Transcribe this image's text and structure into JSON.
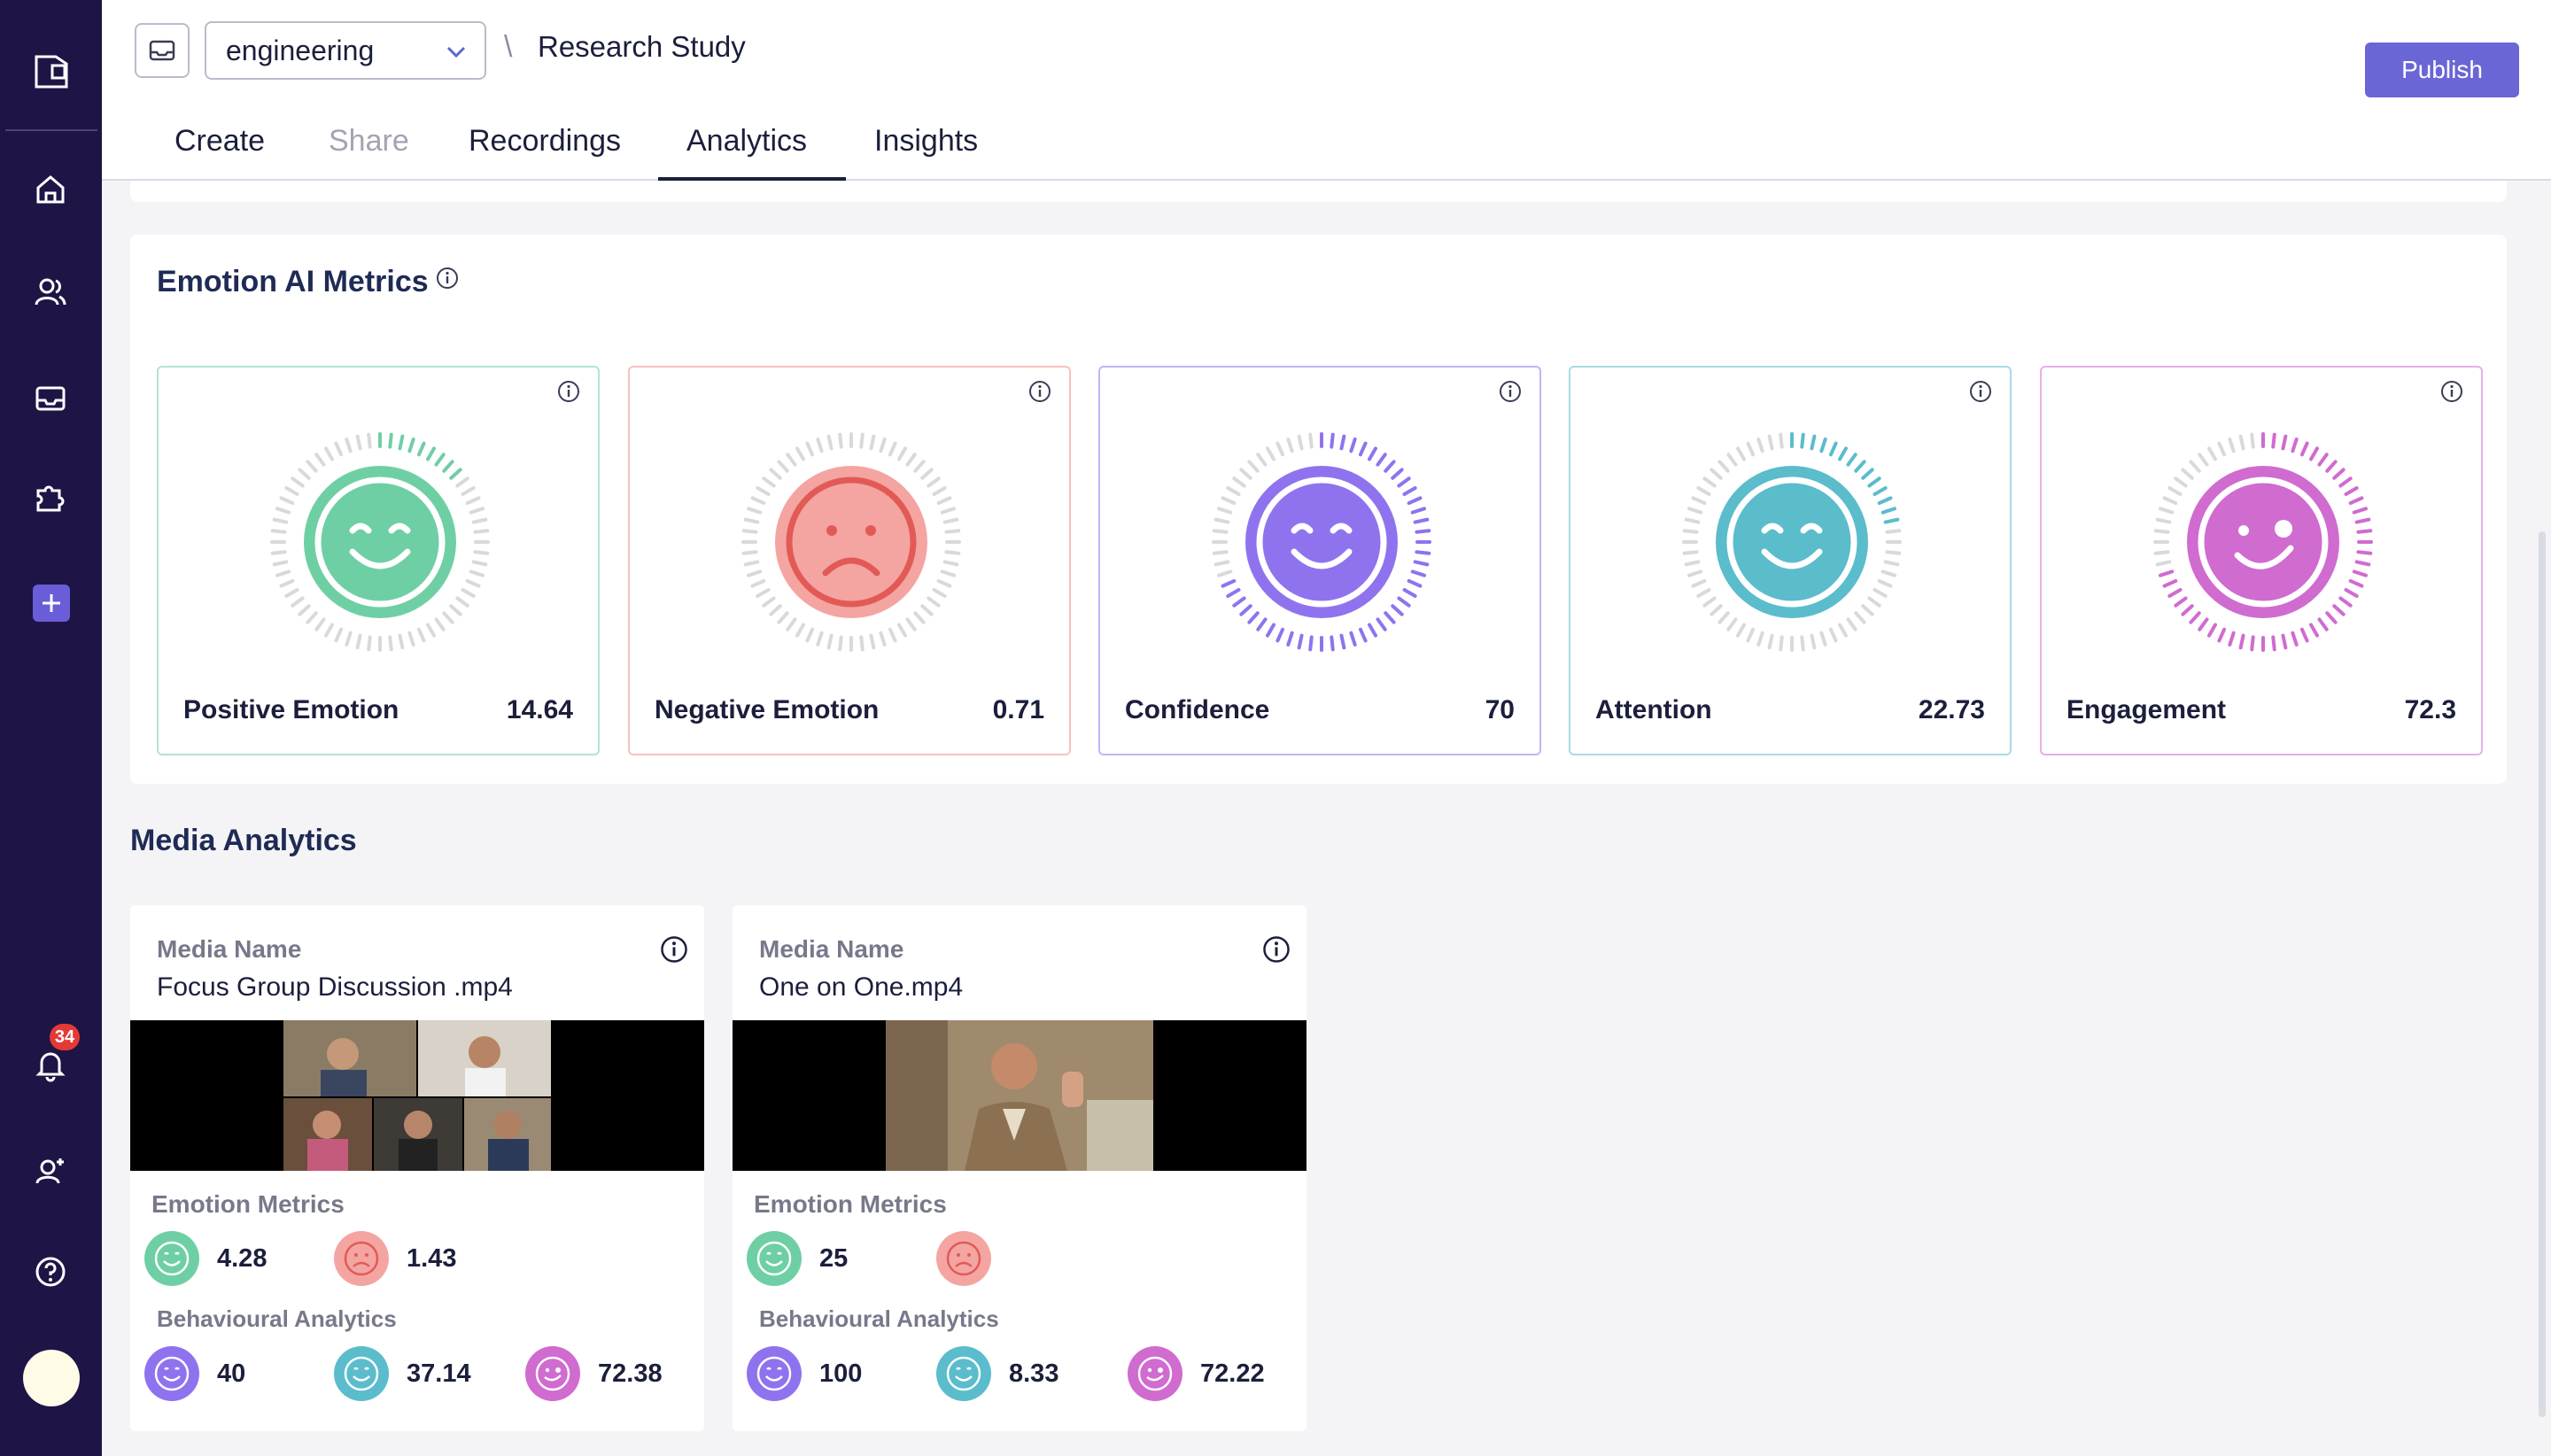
{
  "sidebar": {
    "notification_count": "34"
  },
  "header": {
    "workspace_select": "engineering",
    "breadcrumb_separator": "\\",
    "project_title": "Research Study",
    "publish_label": "Publish",
    "tabs": [
      {
        "label": "Create"
      },
      {
        "label": "Share"
      },
      {
        "label": "Recordings"
      },
      {
        "label": "Analytics"
      },
      {
        "label": "Insights"
      }
    ],
    "active_tab": "Analytics"
  },
  "emotion_panel": {
    "title": "Emotion AI Metrics",
    "metrics": [
      {
        "label": "Positive Emotion",
        "value": "14.64",
        "fill": 0.1464,
        "color": "#6fcfa4",
        "icon": "smile-icon"
      },
      {
        "label": "Negative Emotion",
        "value": "0.71",
        "fill": 0.0071,
        "color": "#f08a87",
        "icon": "frown-icon"
      },
      {
        "label": "Confidence",
        "value": "70",
        "fill": 0.7,
        "color": "#8f73ee",
        "icon": "smile-icon"
      },
      {
        "label": "Attention",
        "value": "22.73",
        "fill": 0.2273,
        "color": "#5bbccc",
        "icon": "smile-icon"
      },
      {
        "label": "Engagement",
        "value": "72.3",
        "fill": 0.723,
        "color": "#d06bd0",
        "icon": "wink-icon"
      }
    ]
  },
  "media_analytics": {
    "title": "Media Analytics",
    "media": [
      {
        "name_label": "Media Name",
        "name": "Focus Group Discussion .mp4",
        "emotion_label": "Emotion Metrics",
        "positive": "4.28",
        "negative": "1.43",
        "behaviour_label": "Behavioural Analytics",
        "confidence": "40",
        "attention": "37.14",
        "engagement": "72.38"
      },
      {
        "name_label": "Media Name",
        "name": "One on One.mp4",
        "emotion_label": "Emotion Metrics",
        "positive": "25",
        "negative": "",
        "behaviour_label": "Behavioural Analytics",
        "confidence": "100",
        "attention": "8.33",
        "engagement": "72.22"
      }
    ]
  },
  "colors": {
    "sidebar": "#1e1446",
    "accent": "#6b66d5",
    "positive": "#6fcfa4",
    "negative": "#f08a87",
    "confidence": "#8f73ee",
    "attention": "#5bbccc",
    "engagement": "#d06bd0"
  }
}
